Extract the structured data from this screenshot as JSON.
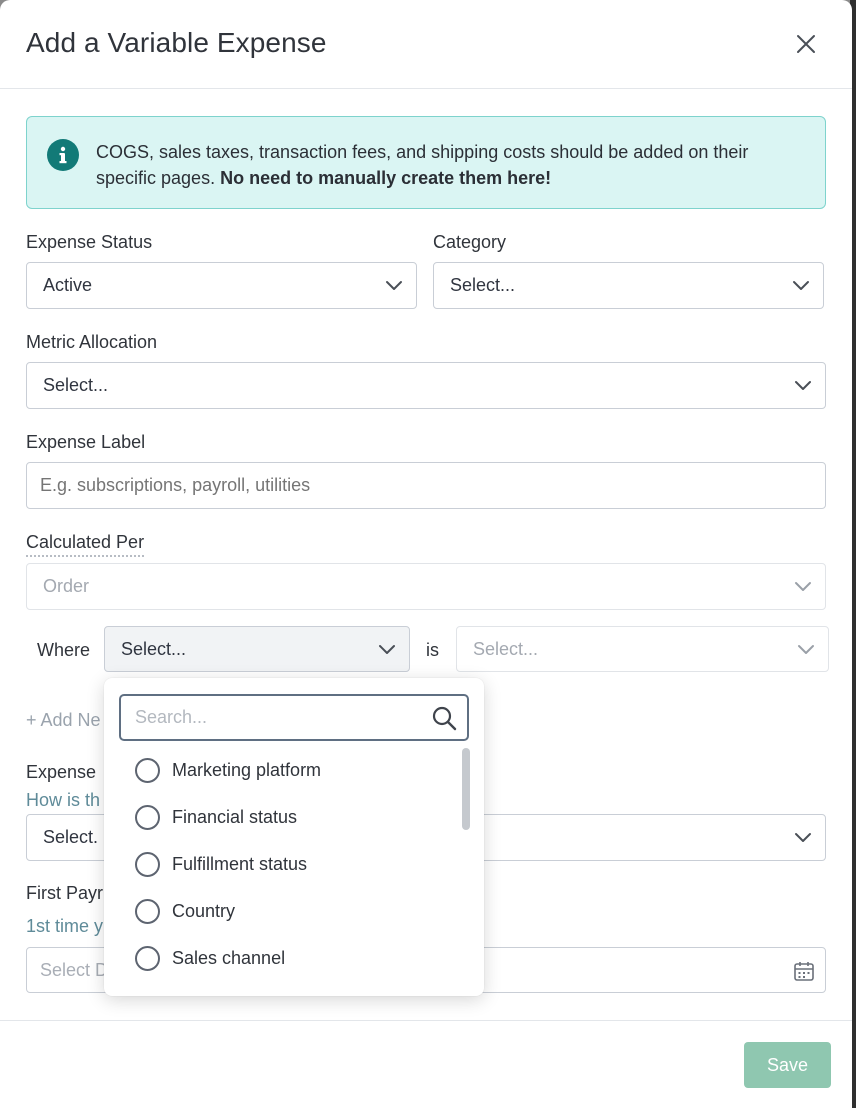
{
  "modal": {
    "title": "Add a Variable Expense",
    "close_icon": "close-icon"
  },
  "banner": {
    "icon": "info-icon",
    "text_regular": "COGS, sales taxes, transaction fees, and shipping costs should be added on their specific pages. ",
    "text_bold": "No need to manually create them here!"
  },
  "form": {
    "expense_status": {
      "label": "Expense Status",
      "value": "Active"
    },
    "category": {
      "label": "Category",
      "value": "Select..."
    },
    "metric_allocation": {
      "label": "Metric Allocation",
      "value": "Select..."
    },
    "expense_label": {
      "label": "Expense Label",
      "placeholder": "E.g. subscriptions, payroll, utilities"
    },
    "calculated_per": {
      "label": "Calculated Per",
      "value": "Order"
    },
    "where": {
      "label": "Where",
      "value": "Select...",
      "is_label": "is",
      "is_value": "Select..."
    },
    "add_new": {
      "label": "+ Add Ne"
    },
    "expense_section": {
      "label": "Expense",
      "sublabel": "How is th",
      "value": "Select."
    },
    "first_payment": {
      "label": "First Payr",
      "sublabel": "1st time y",
      "placeholder": "Select D"
    }
  },
  "dropdown": {
    "search_placeholder": "Search...",
    "options": [
      {
        "label": "Marketing platform"
      },
      {
        "label": "Financial status"
      },
      {
        "label": "Fulfillment status"
      },
      {
        "label": "Country"
      },
      {
        "label": "Sales channel"
      }
    ]
  },
  "footer": {
    "save_label": "Save"
  },
  "colors": {
    "accent": "#127a77",
    "banner_bg": "#daf5f3",
    "save_button": "#8fc7b0"
  }
}
